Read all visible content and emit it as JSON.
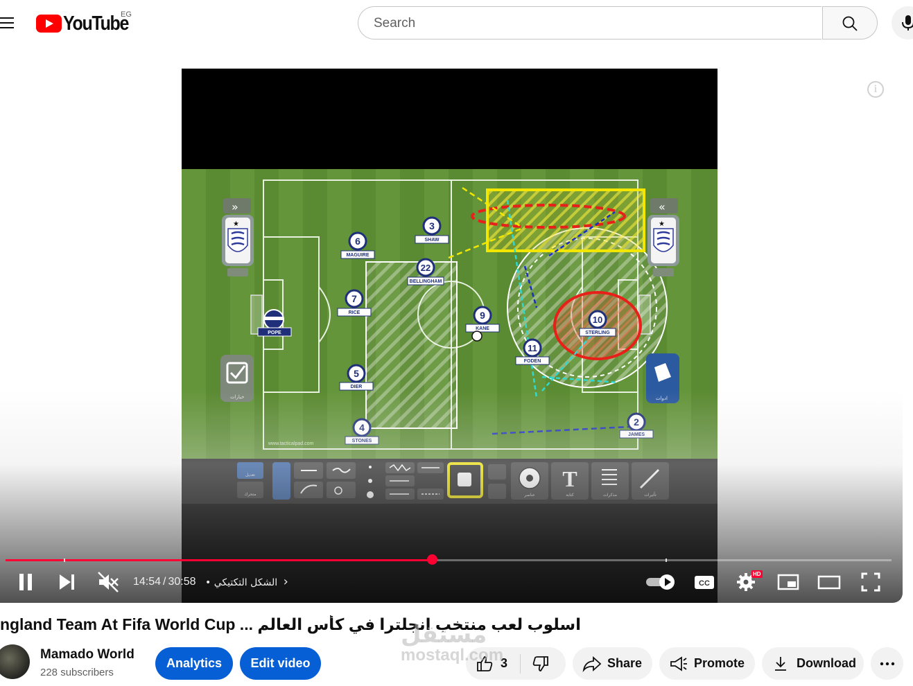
{
  "header": {
    "logo_text": "YouTube",
    "country_code": "EG",
    "search_placeholder": "Search",
    "menu_icon": "hamburger-menu-icon",
    "search_icon": "search-icon",
    "mic_icon": "microphone-icon"
  },
  "video": {
    "tactic_board": {
      "players": [
        {
          "number": "6",
          "name": "MAGUIRE"
        },
        {
          "number": "3",
          "name": "SHAW"
        },
        {
          "number": "22",
          "name": "BELLINGHAM"
        },
        {
          "number": "7",
          "name": "RICE"
        },
        {
          "number": "9",
          "name": "KANE"
        },
        {
          "number": "10",
          "name": "STERLING"
        },
        {
          "number": "11",
          "name": "FODEN"
        },
        {
          "number": "5",
          "name": "DIER"
        },
        {
          "number": "4",
          "name": "STONES"
        },
        {
          "number": "2",
          "name": "JAMES"
        }
      ],
      "goalkeeper": "POPE",
      "watermark_site": "www.tacticalpad.com",
      "left_panel_label": "خيارات",
      "right_panel_label": "ادوات",
      "toolbar_labels": {
        "edit": "تعديل",
        "move": "متحرك",
        "elements": "عناصر",
        "text": "كتابة",
        "notes": "مذكرات",
        "magic": "تأثيرات"
      }
    }
  },
  "player_controls": {
    "current_time": "14:54",
    "separator": "/",
    "duration": "30:58",
    "chapter_bullet": "•",
    "chapter_title": "الشكل التكتيكي",
    "progress_played_fraction": 0.482,
    "chapter_marks_fraction": [
      0.066,
      0.745
    ],
    "hd_badge": "HD",
    "autoplay_on": true
  },
  "title": "اسلوب لعب منتخب انجلترا في كأس العالم ... Tactics Of England Team At Fifa World Cup",
  "channel": {
    "name": "Mamado World",
    "subscribers": "228 subscribers"
  },
  "actions": {
    "analytics_label": "Analytics",
    "edit_video_label": "Edit video",
    "like_count": "3",
    "share_label": "Share",
    "promote_label": "Promote",
    "download_label": "Download"
  },
  "overlay_watermark": {
    "arabic": "مستقل",
    "latin": "mostaql.com"
  },
  "colors": {
    "brand_red": "#ff0000",
    "progress_red": "#ff0033",
    "button_blue": "#065fd4",
    "pitch_green": "#5b8c32"
  }
}
